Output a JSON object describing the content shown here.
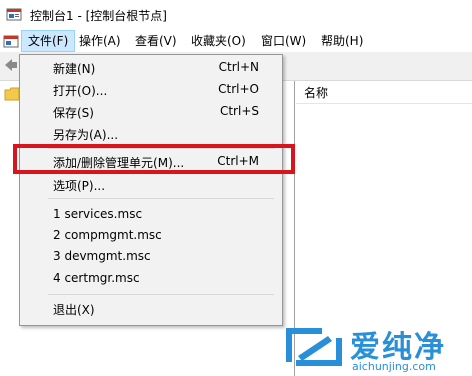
{
  "window": {
    "title": "控制台1 - [控制台根节点]"
  },
  "menubar": {
    "items": [
      {
        "label": "文件(F)"
      },
      {
        "label": "操作(A)"
      },
      {
        "label": "查看(V)"
      },
      {
        "label": "收藏夹(O)"
      },
      {
        "label": "窗口(W)"
      },
      {
        "label": "帮助(H)"
      }
    ]
  },
  "list_pane": {
    "column_name": "名称"
  },
  "file_menu": {
    "new": {
      "label": "新建(N)",
      "shortcut": "Ctrl+N"
    },
    "open": {
      "label": "打开(O)...",
      "shortcut": "Ctrl+O"
    },
    "save": {
      "label": "保存(S)",
      "shortcut": "Ctrl+S"
    },
    "save_as": {
      "label": "另存为(A)..."
    },
    "add_remove_snapin": {
      "label": "添加/删除管理单元(M)...",
      "shortcut": "Ctrl+M"
    },
    "options": {
      "label": "选项(P)..."
    },
    "recent": [
      {
        "label": "1 services.msc"
      },
      {
        "label": "2 compmgmt.msc"
      },
      {
        "label": "3 devmgmt.msc"
      },
      {
        "label": "4 certmgr.msc"
      }
    ],
    "exit": {
      "label": "退出(X)"
    }
  },
  "watermark": {
    "cn": "爱纯净",
    "en": "aichunjing.com",
    "color": "#2a8fd9"
  },
  "highlight_color": "#d8141d",
  "icons": [
    "mmc-console-icon",
    "system-menu-icon",
    "back-arrow-icon",
    "folder-icon"
  ]
}
